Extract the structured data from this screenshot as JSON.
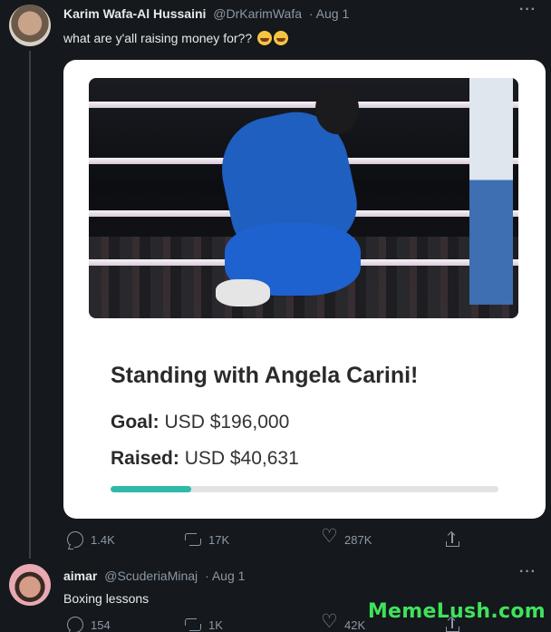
{
  "tweet1": {
    "display_name": "Karim Wafa-Al Hussaini",
    "handle": "@DrKarimWafa",
    "date": "· Aug 1",
    "more": "···",
    "text": "what are y'all raising money for??",
    "emoji": [
      "loudly-crying-face",
      "loudly-crying-face"
    ],
    "card": {
      "title": "Standing with Angela Carini!",
      "goal_label": "Goal:",
      "goal_value": "USD $196,000",
      "raised_label": "Raised:",
      "raised_value": "USD $40,631",
      "progress_fraction": 0.207
    },
    "actions": {
      "replies": "1.4K",
      "retweets": "17K",
      "likes": "287K"
    }
  },
  "tweet2": {
    "display_name": "aimar",
    "handle": "@ScuderiaMinaj",
    "date": "· Aug 1",
    "more": "···",
    "text": "Boxing lessons",
    "actions": {
      "replies": "154",
      "retweets": "1K",
      "likes": "42K"
    }
  },
  "watermark": "MemeLush.com",
  "colors": {
    "background": "#15181c",
    "progress": "#30b8a8",
    "watermark": "#3fe25c"
  }
}
